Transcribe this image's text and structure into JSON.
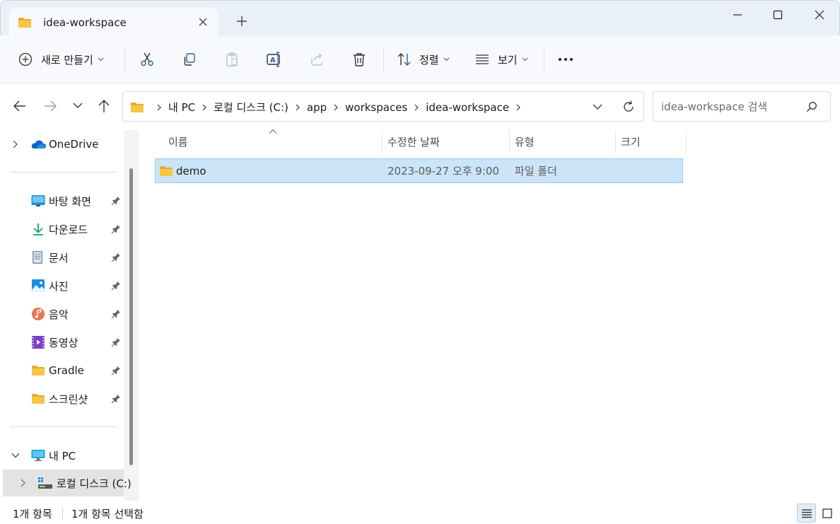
{
  "window": {
    "tab_title": "idea-workspace"
  },
  "toolbar": {
    "new_label": "새로 만들기",
    "sort_label": "정렬",
    "view_label": "보기",
    "more_label": "•••"
  },
  "address": {
    "breadcrumbs": [
      "내 PC",
      "로컬 디스크 (C:)",
      "app",
      "workspaces",
      "idea-workspace"
    ]
  },
  "search": {
    "placeholder": "idea-workspace 검색"
  },
  "sidebar": {
    "onedrive": "OneDrive",
    "quick_access": [
      {
        "label": "바탕 화면",
        "icon": "desktop-icon"
      },
      {
        "label": "다운로드",
        "icon": "download-icon"
      },
      {
        "label": "문서",
        "icon": "document-icon"
      },
      {
        "label": "사진",
        "icon": "pictures-icon"
      },
      {
        "label": "음악",
        "icon": "music-icon"
      },
      {
        "label": "동영상",
        "icon": "video-icon"
      },
      {
        "label": "Gradle",
        "icon": "folder-icon"
      },
      {
        "label": "스크린샷",
        "icon": "folder-icon"
      }
    ],
    "this_pc": "내 PC",
    "local_disk": "로컬 디스크 (C:)"
  },
  "columns": {
    "name": "이름",
    "modified": "수정한 날짜",
    "type": "유형",
    "size": "크기"
  },
  "files": [
    {
      "name": "demo",
      "modified": "2023-09-27 오후 9:00",
      "type": "파일 폴더",
      "size": ""
    }
  ],
  "status": {
    "item_count": "1개 항목",
    "selected": "1개 항목 선택함"
  },
  "colors": {
    "accent": "#0067c0",
    "selection": "#cce4f7",
    "folder": "#f8c645"
  }
}
